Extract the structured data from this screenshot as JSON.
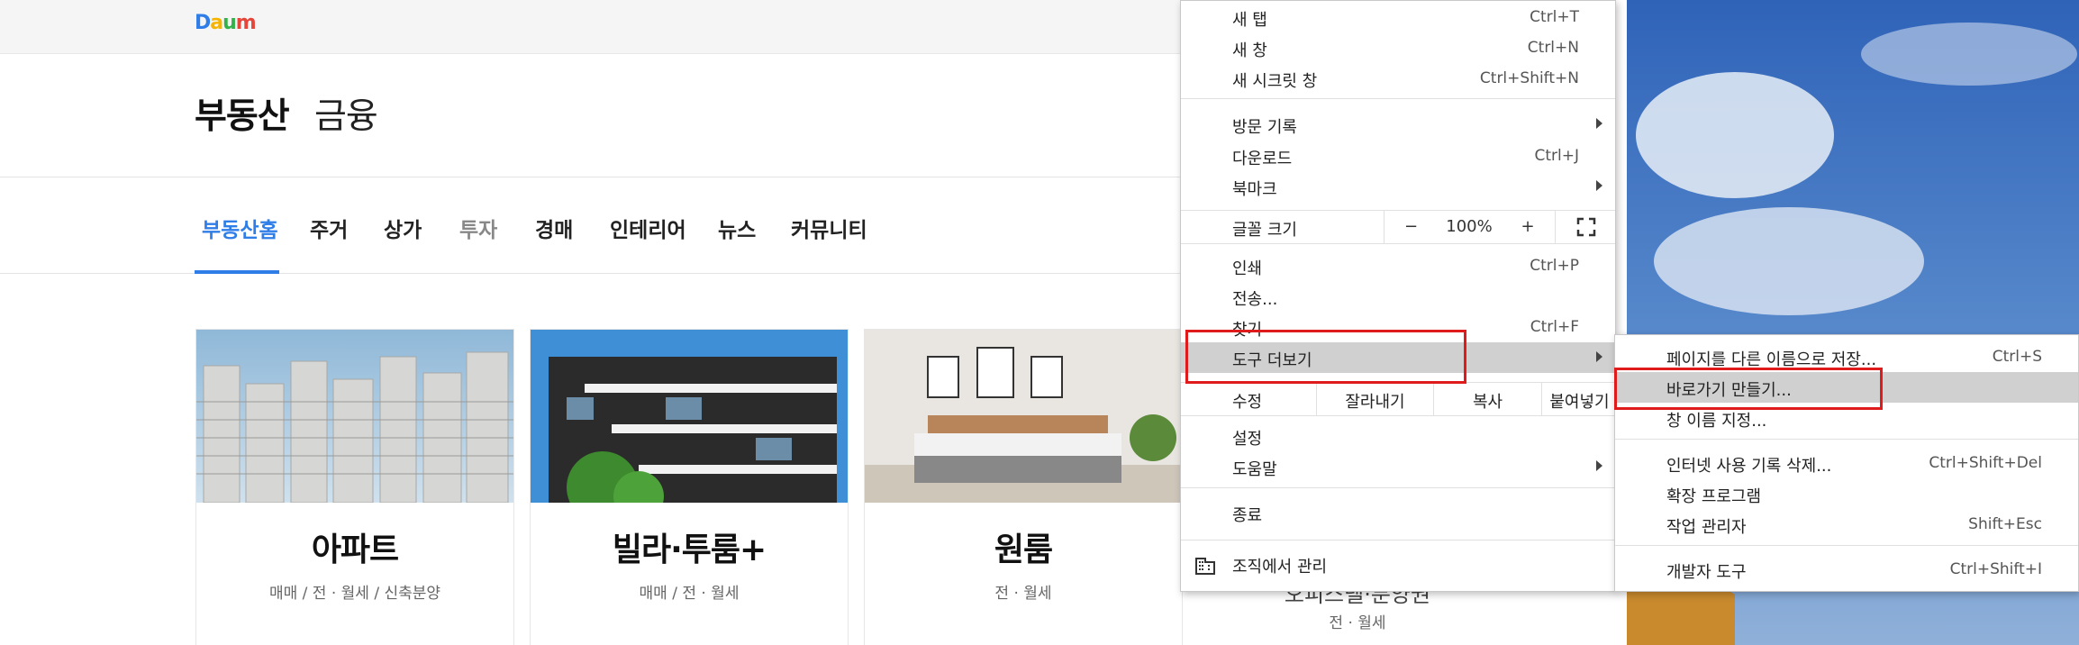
{
  "logo": {
    "text": "Daum",
    "letters": [
      "D",
      "a",
      "u",
      "m"
    ]
  },
  "brand": {
    "main": "부동산",
    "sub": "금융"
  },
  "nav": {
    "tabs": [
      {
        "label": "부동산홈",
        "state": "active"
      },
      {
        "label": "주거",
        "state": "normal"
      },
      {
        "label": "상가",
        "state": "normal"
      },
      {
        "label": "투자",
        "state": "muted"
      },
      {
        "label": "경매",
        "state": "normal"
      },
      {
        "label": "인테리어",
        "state": "normal"
      },
      {
        "label": "뉴스",
        "state": "normal"
      },
      {
        "label": "커뮤니티",
        "state": "normal"
      }
    ]
  },
  "cards": [
    {
      "title": "아파트",
      "sub": "매매 / 전 · 월세 / 신축분양"
    },
    {
      "title": "빌라·투룸+",
      "sub": "매매 / 전 · 월세"
    },
    {
      "title": "원룸",
      "sub": "전 · 월세"
    }
  ],
  "card4": {
    "partial_title": "오피스텔·분양권",
    "sub": "전 · 월세"
  },
  "menu": {
    "new_tab": {
      "label": "새 탭",
      "shortcut": "Ctrl+T"
    },
    "new_window": {
      "label": "새 창",
      "shortcut": "Ctrl+N"
    },
    "incognito": {
      "label": "새 시크릿 창",
      "shortcut": "Ctrl+Shift+N"
    },
    "history": {
      "label": "방문 기록"
    },
    "downloads": {
      "label": "다운로드",
      "shortcut": "Ctrl+J"
    },
    "bookmarks": {
      "label": "북마크"
    },
    "zoom": {
      "label": "글꼴 크기",
      "minus": "−",
      "value": "100%",
      "plus": "+"
    },
    "print": {
      "label": "인쇄",
      "shortcut": "Ctrl+P"
    },
    "cast": {
      "label": "전송..."
    },
    "find": {
      "label": "찾기",
      "shortcut": "Ctrl+F"
    },
    "more_tools": {
      "label": "도구 더보기"
    },
    "edit": {
      "label": "수정",
      "cut": "잘라내기",
      "copy": "복사",
      "paste": "붙여넣기"
    },
    "settings": {
      "label": "설정"
    },
    "help": {
      "label": "도움말"
    },
    "exit": {
      "label": "종료"
    },
    "managed": {
      "label": "조직에서 관리"
    }
  },
  "submenu": {
    "save_as": {
      "label": "페이지를 다른 이름으로 저장...",
      "shortcut": "Ctrl+S"
    },
    "create_shortcut": {
      "label": "바로가기 만들기..."
    },
    "name_window": {
      "label": "창 이름 지정..."
    },
    "clear_data": {
      "label": "인터넷 사용 기록 삭제...",
      "shortcut": "Ctrl+Shift+Del"
    },
    "extensions": {
      "label": "확장 프로그램"
    },
    "task_manager": {
      "label": "작업 관리자",
      "shortcut": "Shift+Esc"
    },
    "devtools": {
      "label": "개발자 도구",
      "shortcut": "Ctrl+Shift+I"
    }
  },
  "colors": {
    "accent": "#2f7ee8",
    "highlight": "#d0d0d0",
    "annotation": "#e01b1b"
  }
}
